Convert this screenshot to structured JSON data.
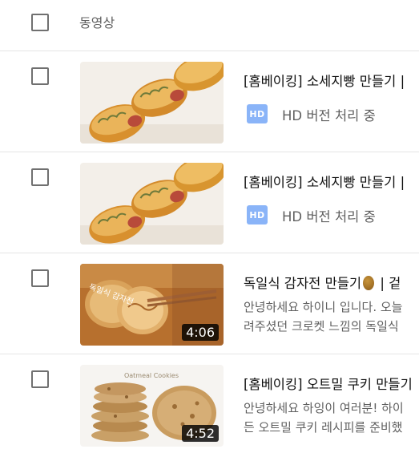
{
  "header": {
    "column_label": "동영상"
  },
  "rows": [
    {
      "title": "[홈베이킹] 소세지빵 만들기 |",
      "status_badge": "HD",
      "status_text": "HD 버전 처리 중"
    },
    {
      "title": "[홈베이킹] 소세지빵 만들기 |",
      "status_badge": "HD",
      "status_text": "HD 버전 처리 중"
    },
    {
      "title_prefix": "독일식 감자전 만들기",
      "title_suffix": " | 겉",
      "title_icon": "potato-emoji",
      "duration": "4:06",
      "desc_line1": "안녕하세요 하이니 입니다. 오늘",
      "desc_line2": "려주셨던 크로켓 느낌의 독일식",
      "thumb_text": "독일식 감자전"
    },
    {
      "title": "[홈베이킹] 오트밀 쿠키 만들기",
      "duration": "4:52",
      "desc_line1": "안녕하세요 하잉이 여러분! 하이",
      "desc_line2": "든 오트밀 쿠키 레시피를 준비했",
      "thumb_text": "Oatmeal Cookies"
    }
  ]
}
